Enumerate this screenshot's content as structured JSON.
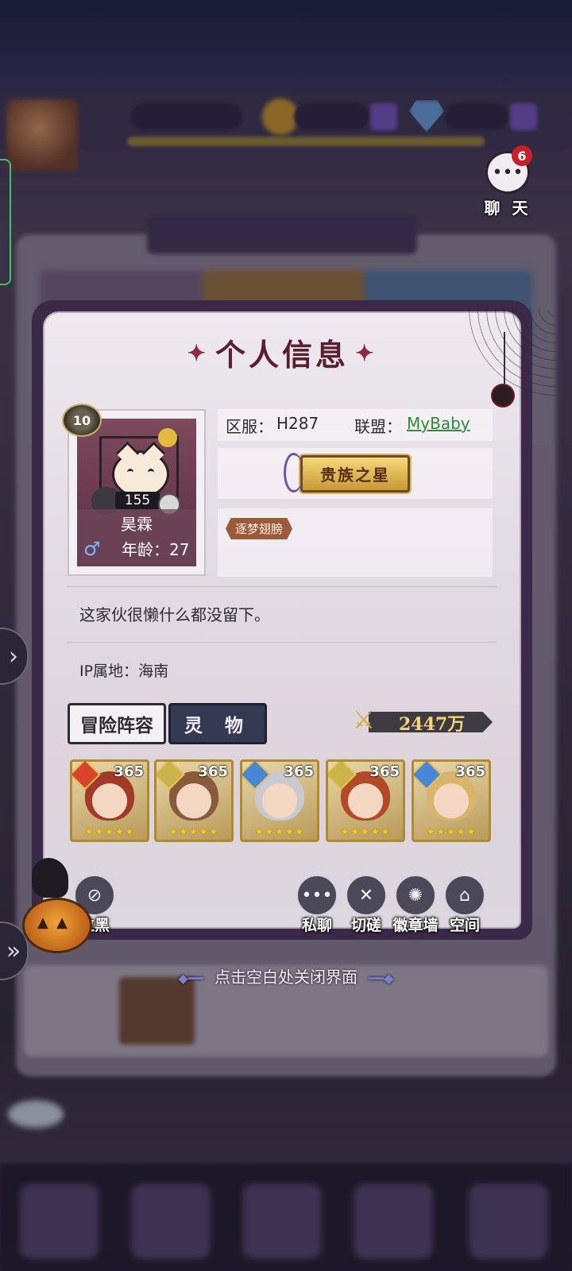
{
  "chat": {
    "label": "聊 天",
    "badge": "6"
  },
  "profile": {
    "title": "个人信息",
    "level": "10",
    "avatar_count": "155",
    "name": "昊霖",
    "gender_symbol": "♂",
    "age_label": "年龄：",
    "age": "27",
    "server_label": "区服：",
    "server": "H287",
    "alliance_label": "联盟：",
    "alliance": "MyBaby",
    "title_badge": "贵族之星",
    "tag": "逐梦翅膀",
    "signature": "这家伙很懒什么都没留下。",
    "ip_label": "IP属地：",
    "ip_location": "海南"
  },
  "tabs": {
    "lineup": "冒险阵容",
    "spirit": "灵 物"
  },
  "power": {
    "value": "2447万"
  },
  "heroes": [
    {
      "level": "365",
      "stars": "★★★★★",
      "element_color": "#d9432c",
      "hair": "#a23a2a"
    },
    {
      "level": "365",
      "stars": "★★★★★",
      "element_color": "#c9b34a",
      "hair": "#8a5a3a"
    },
    {
      "level": "365",
      "stars": "★★★★★",
      "element_color": "#4a86d6",
      "hair": "#c9c9d2"
    },
    {
      "level": "365",
      "stars": "★★★★★",
      "element_color": "#c9b34a",
      "hair": "#b24a2a"
    },
    {
      "level": "365",
      "stars": "★★★★★",
      "element_color": "#4a86d6",
      "hair": "#d8b56a"
    }
  ],
  "actions": {
    "block": "拉黑",
    "private_chat": "私聊",
    "spar": "切磋",
    "badge_wall": "徽章墙",
    "space": "空间"
  },
  "close_hint": "点击空白处关闭界面",
  "colors": {
    "accent": "#5b2030",
    "alliance_link": "#2f8a3a",
    "power_text": "#f4d37c"
  }
}
